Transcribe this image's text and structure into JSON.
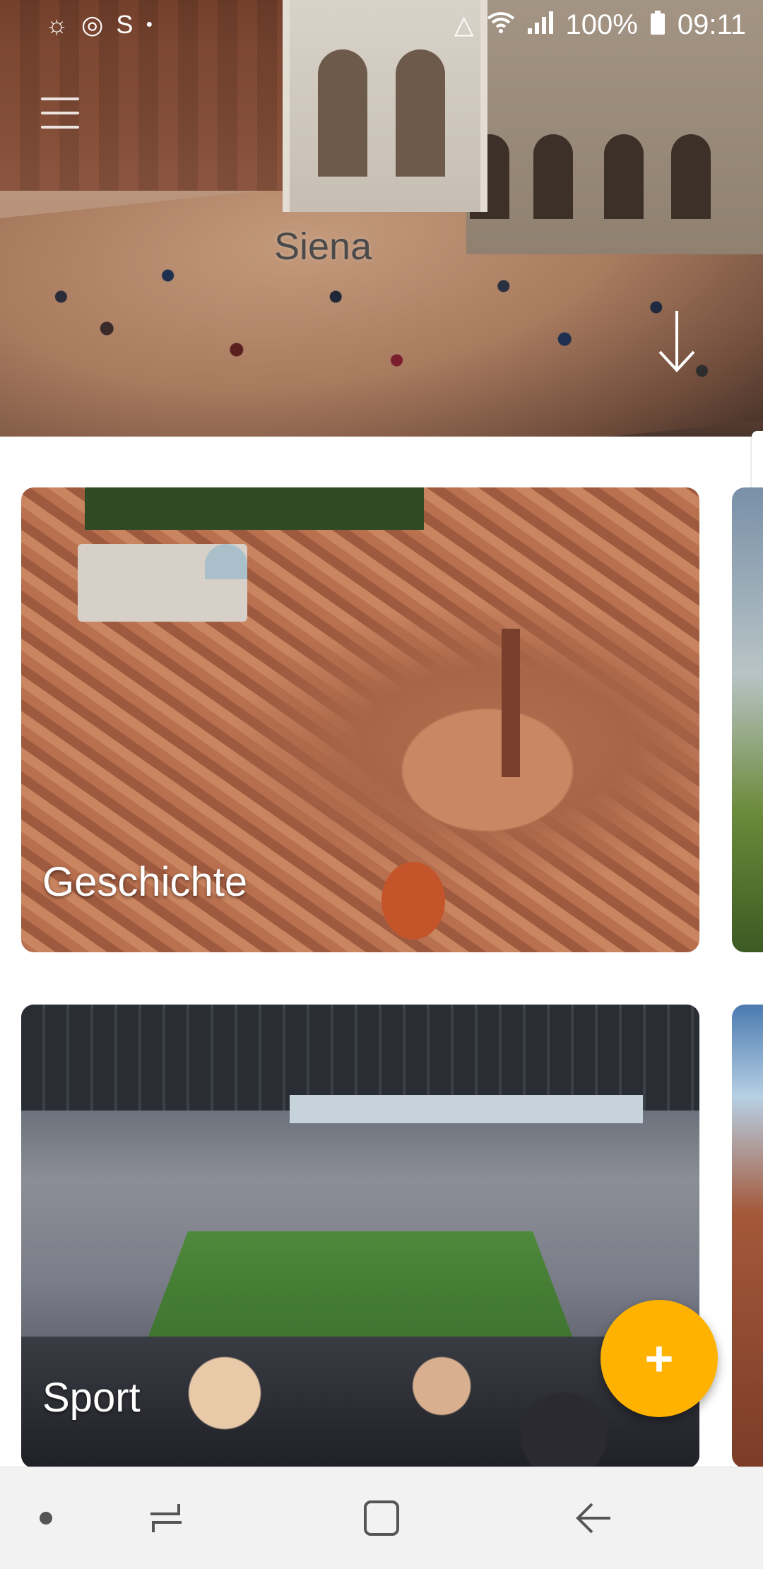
{
  "status_bar": {
    "battery_percent": "100%",
    "time": "09:11",
    "left_icons": [
      "weather-icon",
      "sync-icon",
      "s-app-icon",
      "dot-icon"
    ],
    "right_icons": [
      "recycle-icon",
      "wifi-icon",
      "signal-icon",
      "battery-icon"
    ]
  },
  "hero": {
    "title": "Siena"
  },
  "cards": [
    {
      "label": "Geschichte"
    },
    {
      "label": "Sport"
    }
  ],
  "fab": {
    "label": "+"
  },
  "colors": {
    "accent": "#ffb300",
    "navbar_bg": "#f2f2f2",
    "card_label": "#ffffff"
  }
}
